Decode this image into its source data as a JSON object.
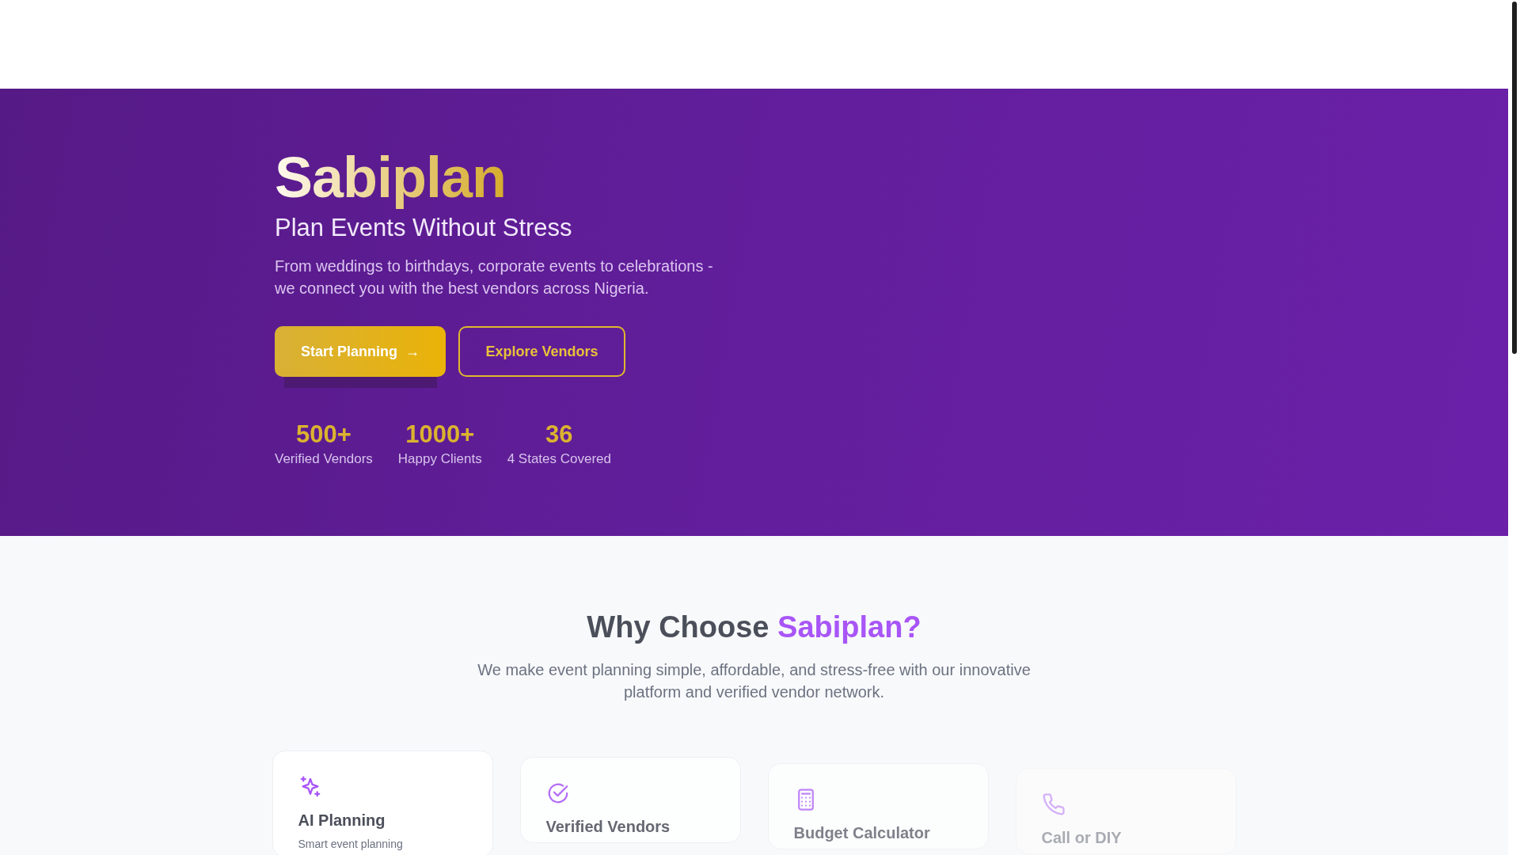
{
  "hero": {
    "brand": "Sabiplan",
    "tagline": "Plan Events Without Stress",
    "description": "From weddings to birthdays, corporate events to celebrations - we connect you with the best vendors across Nigeria.",
    "buttons": [
      {
        "label": "Start Planning",
        "kind": "primary",
        "icon": "→"
      },
      {
        "label": "Explore Vendors",
        "kind": "outline"
      }
    ],
    "stats": [
      {
        "value": "500+",
        "label": "Verified Vendors"
      },
      {
        "value": "1000+",
        "label": "Happy Clients"
      },
      {
        "value": "36",
        "label": "4 States Covered"
      }
    ]
  },
  "features": {
    "heading": "Why Choose",
    "heading_accent": "Sabiplan?",
    "description": "We make event planning simple, affordable, and stress-free with our innovative platform and verified vendor network.",
    "cards": [
      {
        "kind": "sparkles",
        "title": "AI Planning",
        "text": "Smart event planning"
      },
      {
        "kind": "check",
        "title": "Verified Vendors"
      },
      {
        "kind": "calculator",
        "title": "Budget Calculator"
      },
      {
        "kind": "phone",
        "title": "Call or DIY"
      }
    ]
  }
}
